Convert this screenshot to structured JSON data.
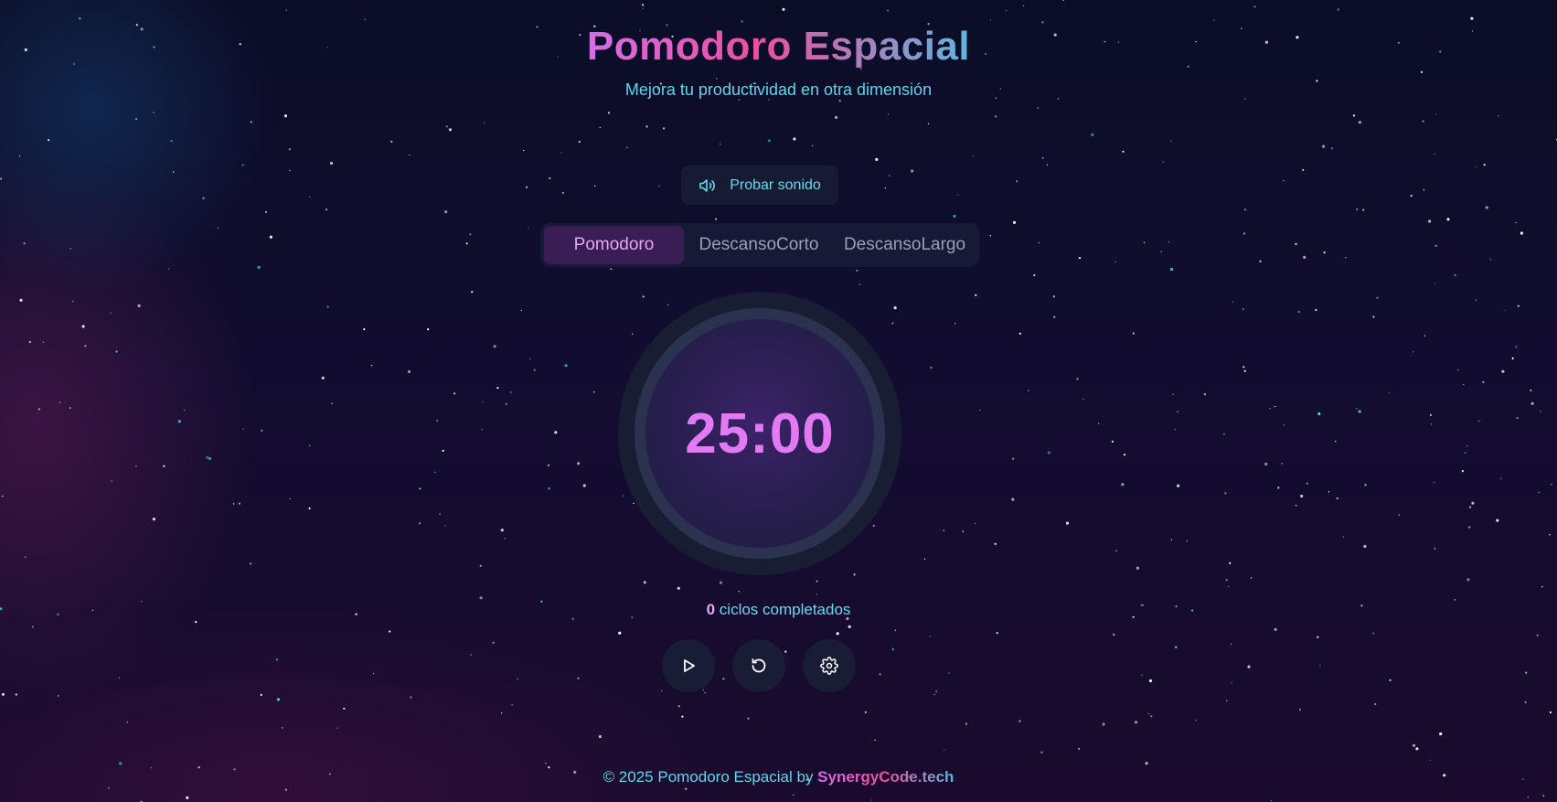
{
  "header": {
    "title": "Pomodoro Espacial",
    "subtitle": "Mejora tu productividad en otra dimensión"
  },
  "sound_button": {
    "label": "Probar sonido",
    "icon": "speaker-icon"
  },
  "tabs": [
    {
      "label": "Pomodoro",
      "active": true
    },
    {
      "label": "DescansoCorto",
      "active": false
    },
    {
      "label": "DescansoLargo",
      "active": false
    }
  ],
  "timer": {
    "display": "25:00"
  },
  "cycles": {
    "count": "0",
    "label": " ciclos completados"
  },
  "controls": {
    "play_icon": "play-icon",
    "reset_icon": "reset-icon",
    "settings_icon": "gear-icon"
  },
  "footer": {
    "prefix": "© 2025 Pomodoro Espacial by ",
    "brand": "SynergyCode.tech"
  },
  "colors": {
    "accent_pink": "#e27bf3",
    "accent_cyan": "#5fd5ea",
    "background": "#0b0d27"
  }
}
